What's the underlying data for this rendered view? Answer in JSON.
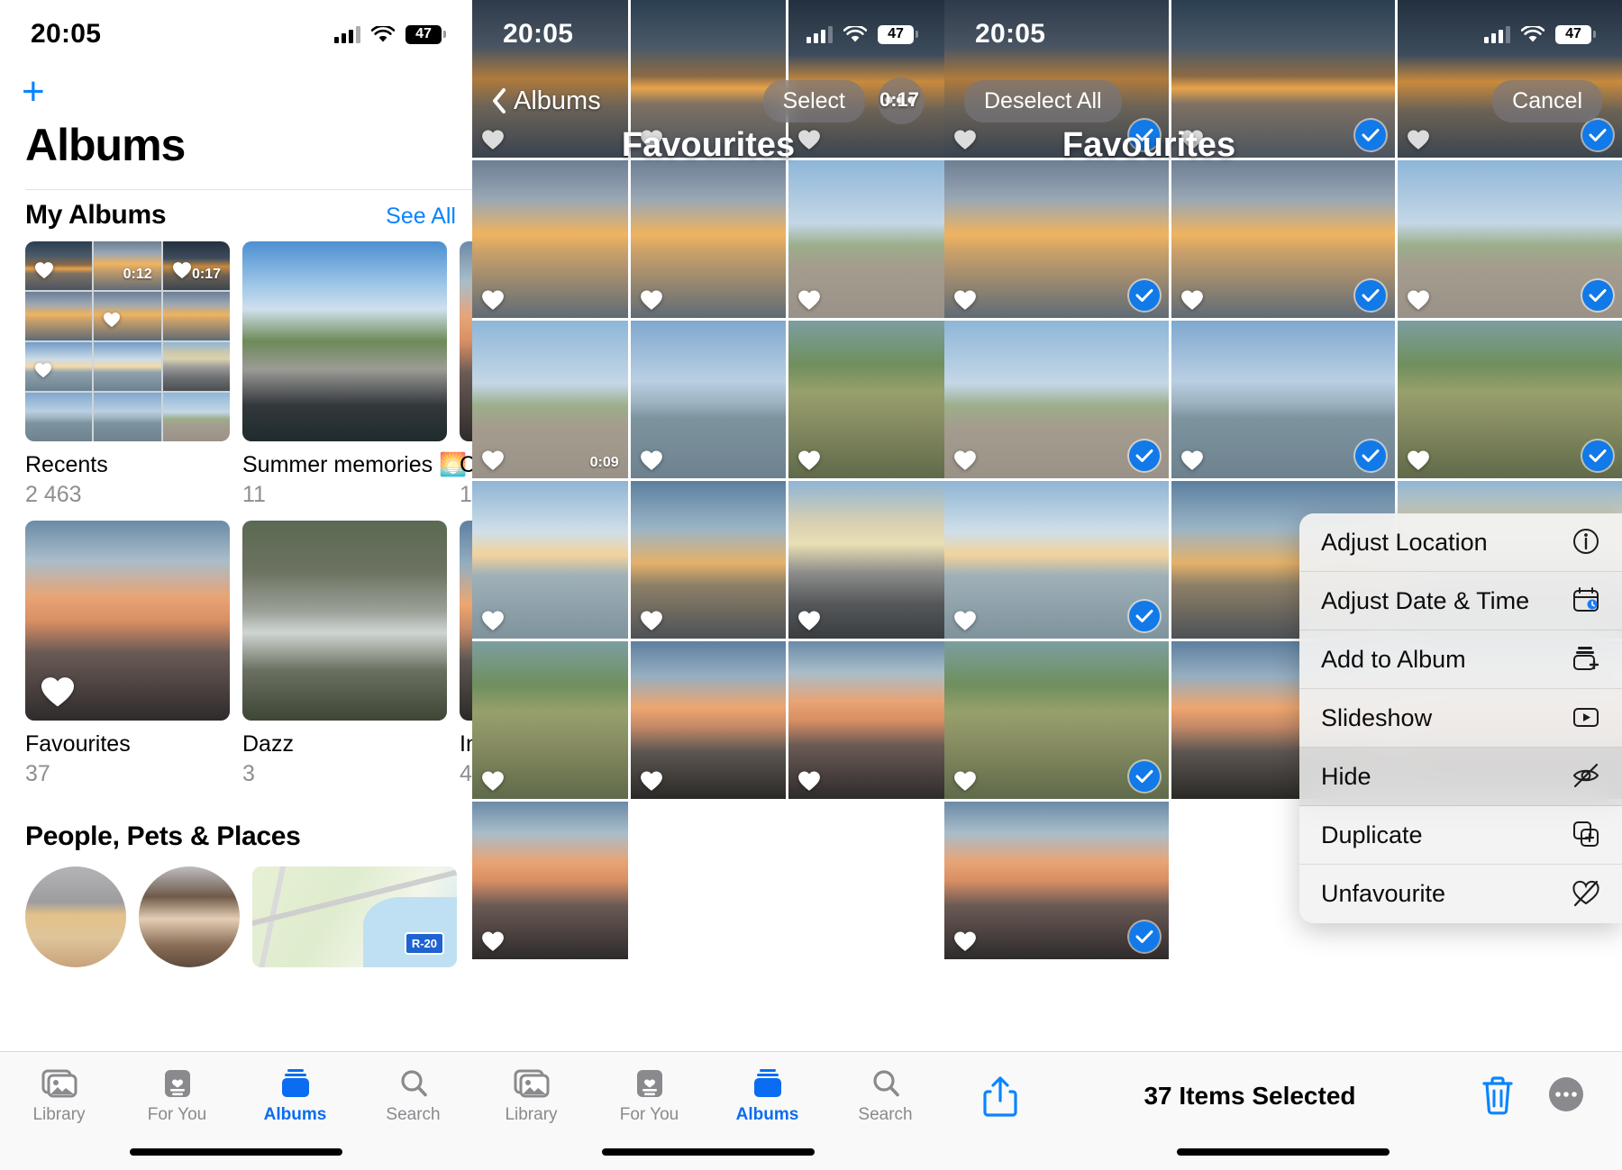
{
  "status_bar": {
    "time": "20:05",
    "battery_percent": "47",
    "wifi": "wifi-icon",
    "signal": "cellular-signal-icon"
  },
  "panel_albums": {
    "add_button": "+",
    "title": "Albums",
    "section_my_albums": {
      "heading": "My Albums",
      "see_all": "See All"
    },
    "albums": [
      {
        "name": "Recents",
        "count": "2 463",
        "badges": [
          "0:12",
          "0:17"
        ]
      },
      {
        "name": "Summer memories 🌅",
        "count": "11"
      },
      {
        "name": "C",
        "count": "1"
      },
      {
        "name": "Favourites",
        "count": "37"
      },
      {
        "name": "Dazz",
        "count": "3"
      },
      {
        "name": "In",
        "count": "4"
      }
    ],
    "section_people": {
      "heading": "People, Pets & Places"
    }
  },
  "tab_bar": {
    "tabs": [
      {
        "label": "Library",
        "icon": "library-icon",
        "active": false
      },
      {
        "label": "For You",
        "icon": "for-you-icon",
        "active": false
      },
      {
        "label": "Albums",
        "icon": "albums-icon",
        "active": true
      },
      {
        "label": "Search",
        "icon": "search-icon",
        "active": false
      }
    ]
  },
  "panel_favourites": {
    "back_label": "Albums",
    "title": "Favourites",
    "select_button": "Select",
    "more_button": "•••",
    "video_durations": [
      "0:17",
      "0:09"
    ]
  },
  "panel_selection": {
    "deselect_all_button": "Deselect All",
    "cancel_button": "Cancel",
    "title": "Favourites",
    "selected_count_label": "37 Items Selected",
    "share_icon": "share-icon",
    "delete_icon": "trash-icon",
    "more_icon": "more-circle-icon"
  },
  "context_menu": {
    "items": [
      {
        "label": "Adjust Location",
        "icon": "location-icon",
        "highlighted": false
      },
      {
        "label": "Adjust Date & Time",
        "icon": "calendar-icon",
        "highlighted": false
      },
      {
        "label": "Add to Album",
        "icon": "add-to-album-icon",
        "highlighted": false
      },
      {
        "label": "Slideshow",
        "icon": "play-rect-icon",
        "highlighted": false
      },
      {
        "label": "Hide",
        "icon": "eye-slash-icon",
        "highlighted": true
      },
      {
        "label": "Duplicate",
        "icon": "duplicate-icon",
        "highlighted": false
      },
      {
        "label": "Unfavourite",
        "icon": "heart-slash-icon",
        "highlighted": false
      }
    ]
  },
  "colors": {
    "accent_blue": "#0a84ff",
    "tab_active_blue": "#0a6cf1",
    "check_blue": "#1279e8",
    "secondary_text": "#8e8e93"
  }
}
